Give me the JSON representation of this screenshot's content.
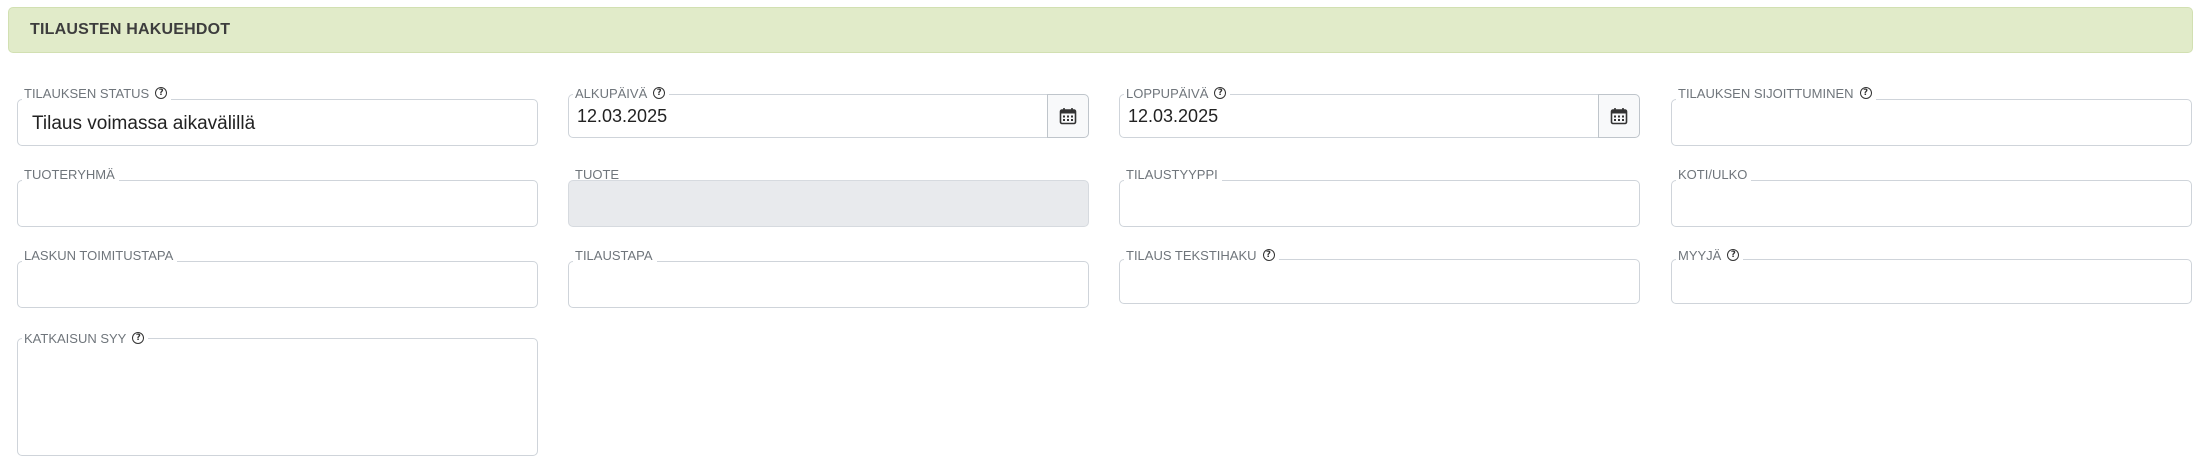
{
  "header": {
    "title": "TILAUSTEN HAKUEHDOT"
  },
  "fields": {
    "status": {
      "label": "TILAUKSEN STATUS",
      "value": "Tilaus voimassa aikavälillä"
    },
    "start_date": {
      "label": "ALKUPÄIVÄ",
      "value": "12.03.2025"
    },
    "end_date": {
      "label": "LOPPUPÄIVÄ",
      "value": "12.03.2025"
    },
    "placement": {
      "label": "TILAUKSEN SIJOITTUMINEN",
      "value": ""
    },
    "product_group": {
      "label": "TUOTERYHMÄ",
      "value": ""
    },
    "product": {
      "label": "TUOTE",
      "value": ""
    },
    "order_type": {
      "label": "TILAUSTYYPPI",
      "value": ""
    },
    "domestic_foreign": {
      "label": "KOTI/ULKO",
      "value": ""
    },
    "invoice_delivery": {
      "label": "LASKUN TOIMITUSTAPA",
      "value": ""
    },
    "order_method": {
      "label": "TILAUSTAPA",
      "value": ""
    },
    "text_search": {
      "label": "TILAUS TEKSTIHAKU",
      "value": ""
    },
    "seller": {
      "label": "MYYJÄ",
      "value": ""
    },
    "termination_reason": {
      "label": "KATKAISUN SYY",
      "value": ""
    }
  },
  "icons": {
    "help": "question-circle-icon",
    "calendar": "calendar-icon"
  },
  "help_glyph": "?"
}
